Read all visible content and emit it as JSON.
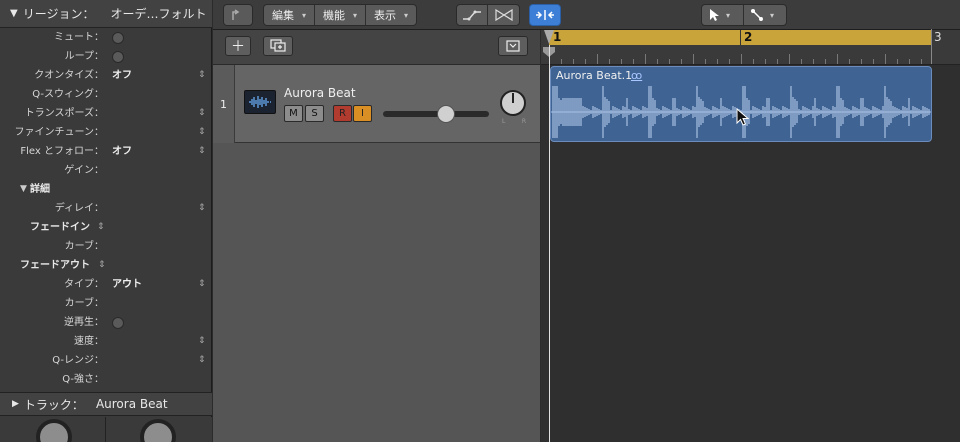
{
  "inspector": {
    "header_label": "リージョン：",
    "header_value": "オーデ…フォルト",
    "rows": {
      "mute": "ミュート：",
      "loop": "ループ：",
      "quantize": "クオンタイズ：",
      "quantize_val": "オフ",
      "qswing": "Q-スウィング：",
      "transpose": "トランスポーズ：",
      "finetune": "ファインチューン：",
      "flex": "Flex とフォロー：",
      "flex_val": "オフ",
      "gain": "ゲイン：",
      "details": "詳細",
      "delay": "ディレイ：",
      "fadein": "フェードイン",
      "curve1": "カーブ：",
      "fadeout": "フェードアウト",
      "type": "タイプ：",
      "type_val": "アウト",
      "curve2": "カーブ：",
      "reverse": "逆再生：",
      "speed": "速度：",
      "qrange": "Q-レンジ：",
      "qstrength": "Q-強さ："
    },
    "track_label": "トラック：",
    "track_value": "Aurora Beat"
  },
  "toolbar": {
    "edit": "編集",
    "function": "機能",
    "view": "表示"
  },
  "track": {
    "number": "1",
    "name": "Aurora Beat",
    "mute": "M",
    "solo": "S",
    "record": "R",
    "input": "I",
    "pan_l": "L",
    "pan_r": "R"
  },
  "ruler": {
    "bar1": "1",
    "bar2": "2",
    "bar3": "3"
  },
  "region": {
    "name": "Aurora Beat.1",
    "link_symbol": "ꝏ"
  },
  "colors": {
    "cycle": "#c9a43a",
    "region": "#3f6392",
    "active_tool": "#3d7fd6"
  }
}
